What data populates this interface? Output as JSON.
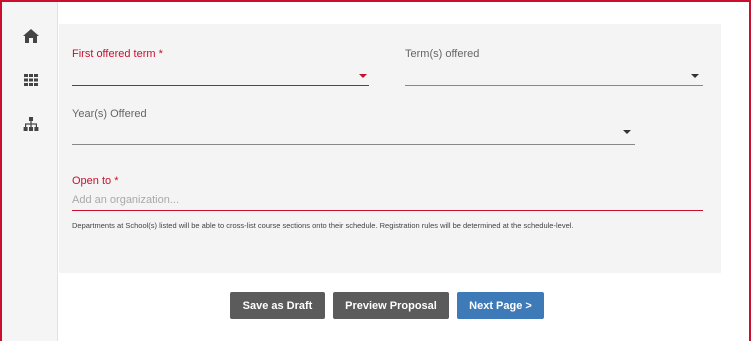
{
  "sidebar": {
    "items": [
      {
        "icon": "home-icon"
      },
      {
        "icon": "grid-icon"
      },
      {
        "icon": "sitemap-icon"
      }
    ]
  },
  "form": {
    "first_offered_term": {
      "label": "First offered term *",
      "value": ""
    },
    "terms_offered": {
      "label": "Term(s) offered",
      "value": ""
    },
    "years_offered": {
      "label": "Year(s) Offered",
      "value": ""
    },
    "open_to": {
      "label": "Open to *",
      "placeholder": "Add an organization..."
    },
    "help_text": "Departments at School(s) listed will be able to cross-list course sections onto their schedule. Registration rules will be determined at the schedule-level."
  },
  "actions": {
    "save_draft": "Save as Draft",
    "preview": "Preview Proposal",
    "next": "Next Page >"
  },
  "colors": {
    "required": "#c8102e",
    "primary": "#3d7ab7",
    "secondary": "#5b5b5b"
  }
}
